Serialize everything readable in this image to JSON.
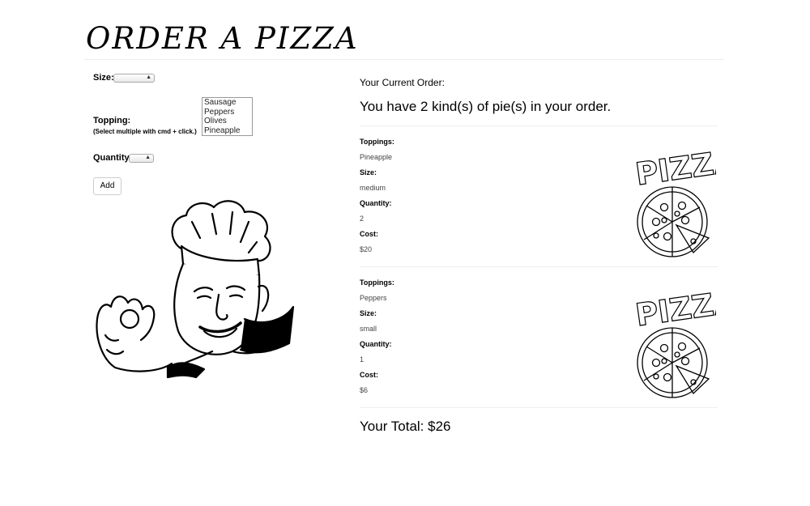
{
  "header": {
    "title": "ORDER A PIZZA"
  },
  "form": {
    "size_label": "Size:",
    "size_value": "",
    "topping_label": "Topping:",
    "topping_hint": "(Select multiple with cmd + click.)",
    "topping_options": [
      "Sausage",
      "Peppers",
      "Olives",
      "Pineapple"
    ],
    "quantity_label": "Quantity:",
    "quantity_value": "",
    "add_button": "Add"
  },
  "order": {
    "heading": "Your Current Order:",
    "summary": "You have 2 kind(s) of pie(s) in your order.",
    "field_labels": {
      "toppings": "Toppings:",
      "size": "Size:",
      "quantity": "Quantity:",
      "cost": "Cost:"
    },
    "items": [
      {
        "toppings": "Pineapple",
        "size": "medium",
        "quantity": "2",
        "cost": "$20",
        "image_text": "PIZZA"
      },
      {
        "toppings": "Peppers",
        "size": "small",
        "quantity": "1",
        "cost": "$6",
        "image_text": "PIZZA"
      }
    ],
    "total": "Your Total: $26"
  }
}
